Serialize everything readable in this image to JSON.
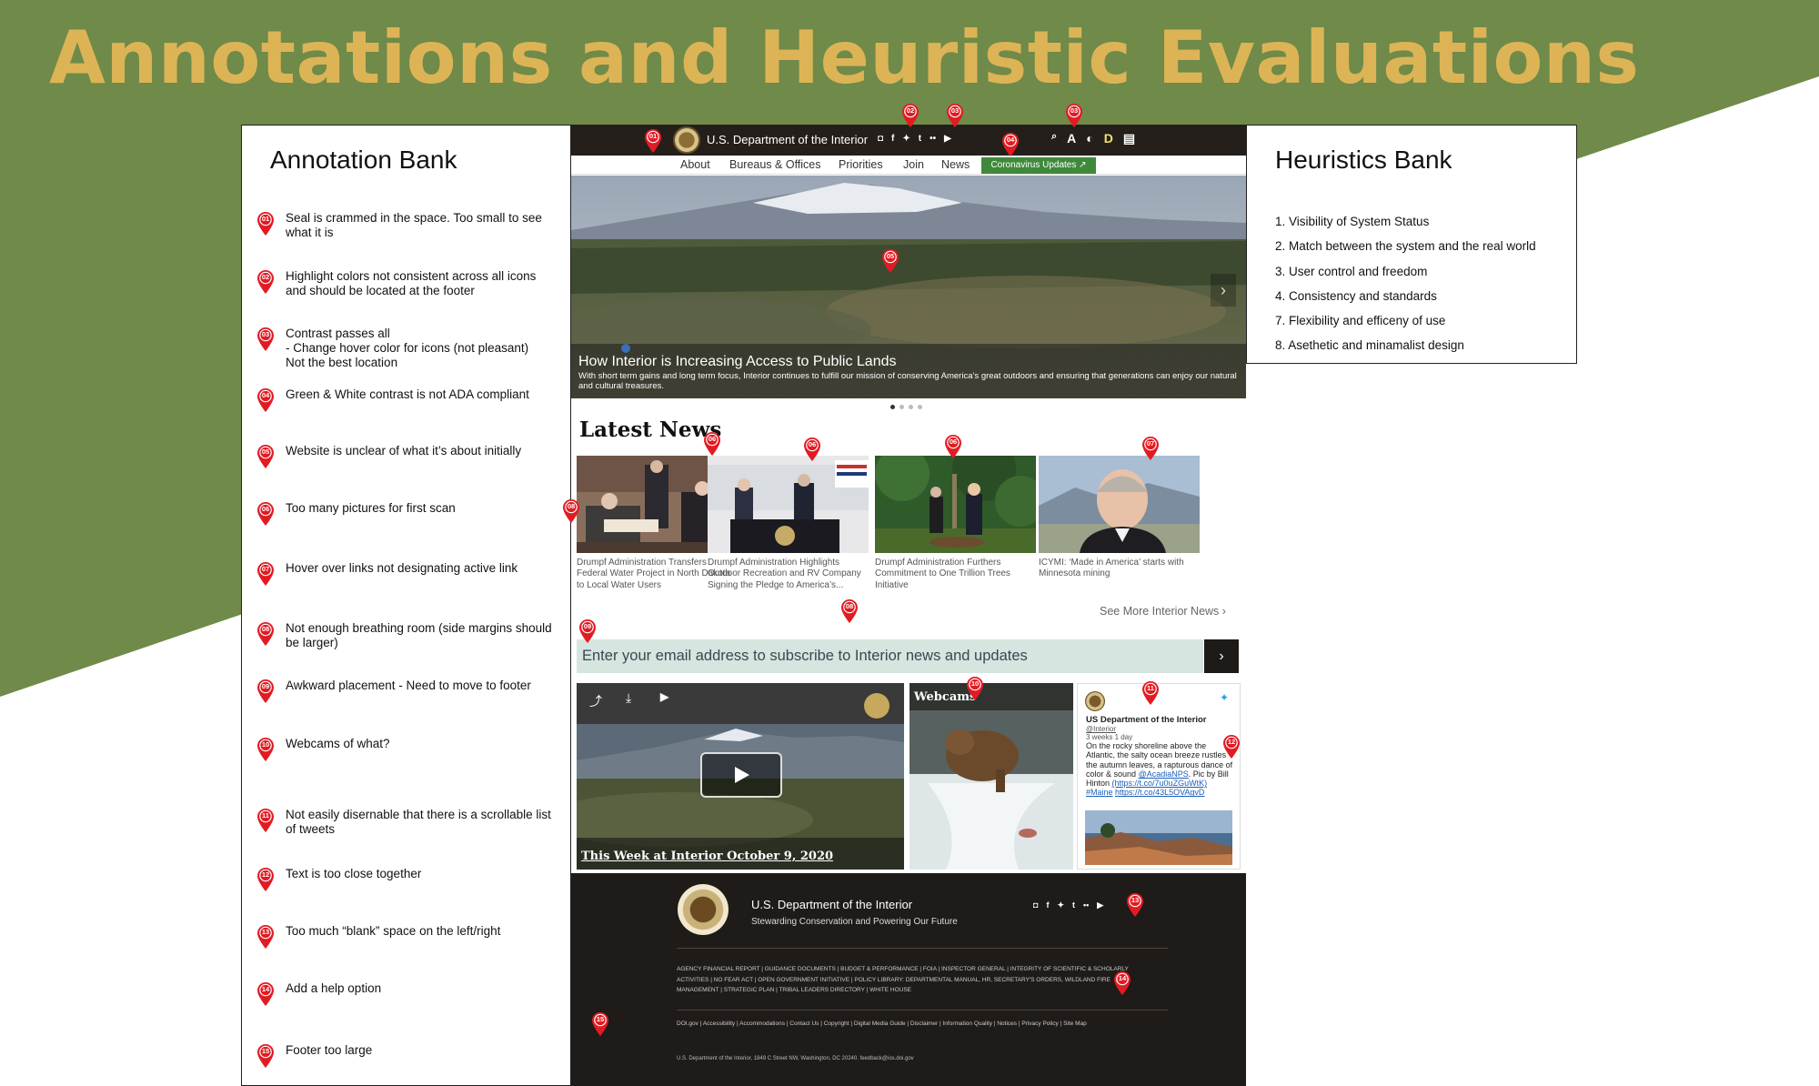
{
  "page": {
    "title": "Annotations and Heuristic Evaluations",
    "colors": {
      "green": "#6f8a49",
      "gold": "#dcb456",
      "pin": "#e21b23"
    }
  },
  "annotation_bank": {
    "title": "Annotation Bank",
    "items": [
      {
        "num": "01",
        "text": "Seal is crammed in the space. Too small to see what it is"
      },
      {
        "num": "02",
        "text": "Highlight colors not consistent across all icons and should be located at the footer"
      },
      {
        "num": "03",
        "text": "Contrast passes all\n - Change hover color for icons (not pleasant)\nNot the best location"
      },
      {
        "num": "04",
        "text": "Green & White contrast is not ADA compliant"
      },
      {
        "num": "05",
        "text": "Website is unclear of what it’s about initially"
      },
      {
        "num": "06",
        "text": "Too many pictures for first scan"
      },
      {
        "num": "07",
        "text": "Hover over links not designating active link"
      },
      {
        "num": "08",
        "text": "Not enough breathing room (side margins should be larger)"
      },
      {
        "num": "09",
        "text": "Awkward placement - Need to move to footer"
      },
      {
        "num": "10",
        "text": "Webcams of what?"
      },
      {
        "num": "11",
        "text": "Not easily disernable that there is a scrollable list of tweets"
      },
      {
        "num": "12",
        "text": "Text is too close together"
      },
      {
        "num": "13",
        "text": "Too much “blank” space on the left/right"
      },
      {
        "num": "14",
        "text": "Add a help option"
      },
      {
        "num": "15",
        "text": "Footer too large"
      }
    ]
  },
  "heuristics_bank": {
    "title": "Heuristics Bank",
    "items": [
      "1. Visibility of System Status",
      "2. Match between the system and the real world",
      "3. User control and freedom",
      "4. Consistency and standards",
      "7. Flexibility and efficeny of use",
      "8. Asethetic and minamalist design"
    ]
  },
  "site": {
    "header": {
      "dept_name": "U.S. Department of the Interior",
      "social_icons": [
        "instagram-icon",
        "facebook-icon",
        "twitter-icon",
        "tumblr-icon",
        "flickr-icon",
        "youtube-icon"
      ],
      "tool_icons": [
        "search-icon",
        "text-size-icon",
        "contrast-icon",
        "dyslexia-font-icon",
        "translate-icon"
      ]
    },
    "nav": {
      "items": [
        "About",
        "Bureaus & Offices",
        "Priorities",
        "Join",
        "News"
      ],
      "covid": "Coronavirus Updates"
    },
    "hero": {
      "title": "How Interior is Increasing Access to Public Lands",
      "description": "With short term gains and long term focus, Interior continues to fulfill our mission of conserving America’s great outdoors and ensuring that generations can enjoy our natural and cultural treasures.",
      "next_arrow": "›",
      "slide_count": 4,
      "active_slide": 1
    },
    "latest_news": {
      "title": "Latest News",
      "items": [
        {
          "caption": "Drumpf Administration Transfers Federal Water Project in North Dakota to Local Water Users"
        },
        {
          "caption": "Drumpf Administration Highlights Outdoor Recreation and RV Company Signing the Pledge to America’s..."
        },
        {
          "caption": "Drumpf Administration Furthers Commitment to One Trillion Trees Initiative"
        },
        {
          "caption": "ICYMI: ‘Made in America’ starts with Minnesota mining"
        }
      ],
      "see_more": "See More Interior News ›"
    },
    "subscribe": {
      "placeholder": "Enter your email address to subscribe to Interior news and updates",
      "button": "›"
    },
    "video": {
      "title": "This Week at Interior October 9, 2020"
    },
    "webcams": {
      "label": "Webcams"
    },
    "tweet": {
      "name": "US Department of the Interior",
      "handle": "@Interior",
      "time": "3 weeks 1 day",
      "text": "On the rocky shoreline above the Atlantic, the salty ocean breeze rustles the autumn leaves, a rapturous dance of color & sound",
      "mention": "@AcadiaNPS",
      "pic_by": ". Pic by Bill Hinton",
      "link1": "(https://t.co/7u0uZGuWtK)",
      "hashtag": "#Maine",
      "link2": "https://t.co/43L5OVAgvD"
    },
    "footer": {
      "dept_name": "U.S. Department of the Interior",
      "tagline": "Stewarding Conservation and Powering Our Future",
      "links_primary": "AGENCY FINANCIAL REPORT  |  GUIDANCE DOCUMENTS  |  BUDGET & PERFORMANCE  |  FOIA  |  INSPECTOR GENERAL  |  INTEGRITY OF SCIENTIFIC & SCHOLARLY ACTIVITIES  |  NO FEAR ACT  |  OPEN GOVERNMENT INITIATIVE  |  POLICY LIBRARY: DEPARTMENTAL MANUAL, HR, SECRETARY'S ORDERS, WILDLAND FIRE MANAGEMENT  |  STRATEGIC PLAN  |  TRIBAL LEADERS DIRECTORY  |  WHITE HOUSE",
      "links_secondary": "DOI.gov  |  Accessibility  |  Accommodations  |  Contact Us  |  Copyright  |  Digital Media Guide  |  Disclaimer  |  Information Quality  |  Notices  |  Privacy Policy  |  Site Map",
      "address": "U.S. Department of the Interior, 1849 C Street NW, Washington, DC 20240. feedback@ios.doi.gov"
    }
  }
}
